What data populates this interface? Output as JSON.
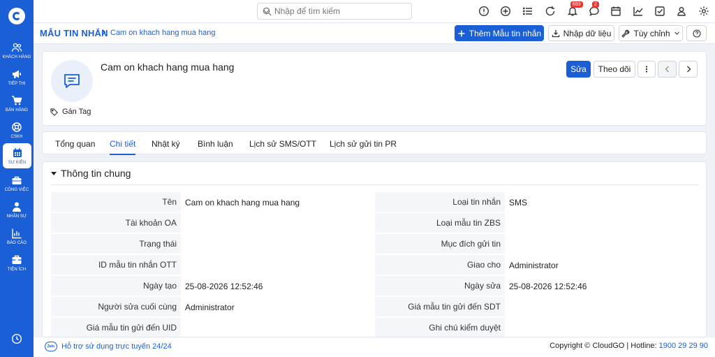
{
  "sidebar": {
    "items": [
      {
        "label": "KHÁCH HÀNG",
        "icon": "users-icon"
      },
      {
        "label": "TIẾP THỊ",
        "icon": "megaphone-icon"
      },
      {
        "label": "BÁN HÀNG",
        "icon": "cart-icon"
      },
      {
        "label": "CSKH",
        "icon": "lifebuoy-icon"
      },
      {
        "label": "SỰ KIỆN",
        "icon": "calendar-icon"
      },
      {
        "label": "CÔNG VIỆC",
        "icon": "briefcase-icon"
      },
      {
        "label": "NHÂN SỰ",
        "icon": "person-icon"
      },
      {
        "label": "BÁO CÁO",
        "icon": "report-icon"
      },
      {
        "label": "TIỆN ÍCH",
        "icon": "toolbox-icon"
      }
    ]
  },
  "topbar": {
    "search_placeholder": "Nhập để tìm kiếm",
    "notification_count": "693",
    "message_count": "2"
  },
  "breadcrumb": {
    "module": "MẪU TIN NHẮN",
    "record": "Cam on khach hang mua hang"
  },
  "actions": {
    "add": "Thêm Mẫu tin nhắn",
    "import": "Nhập dữ liệu",
    "customize": "Tùy chỉnh"
  },
  "record": {
    "title": "Cam on khach hang mua hang",
    "tag_label": "Gán Tag",
    "edit": "Sửa",
    "follow": "Theo dõi"
  },
  "tabs": [
    "Tổng quan",
    "Chi tiết",
    "Nhật ký",
    "Bình luận",
    "Lịch sử SMS/OTT",
    "Lịch sử gửi tin PR"
  ],
  "section": {
    "title": "Thông tin chung",
    "left": [
      {
        "label": "Tên",
        "value": "Cam on khach hang mua hang"
      },
      {
        "label": "Tài khoản OA",
        "value": ""
      },
      {
        "label": "Trạng thái",
        "value": ""
      },
      {
        "label": "ID mẫu tin nhắn OTT",
        "value": ""
      },
      {
        "label": "Ngày tạo",
        "value": "25-08-2026 12:52:46"
      },
      {
        "label": "Người sửa cuối cùng",
        "value": "Administrator"
      },
      {
        "label": "Giá mẫu tin gửi đến UID",
        "value": ""
      }
    ],
    "right": [
      {
        "label": "Loại tin nhắn",
        "value": "SMS"
      },
      {
        "label": "Loại mẫu tin ZBS",
        "value": ""
      },
      {
        "label": "Mục đích gửi tin",
        "value": ""
      },
      {
        "label": "Giao cho",
        "value": "Administrator"
      },
      {
        "label": "Ngày sửa",
        "value": "25-08-2026 12:52:46"
      },
      {
        "label": "Giá mẫu tin gửi đến SDT",
        "value": ""
      },
      {
        "label": "Ghi chú kiểm duyệt",
        "value": ""
      }
    ]
  },
  "footer": {
    "zalo": "Zalo",
    "support": "Hỗ trợ sử dụng trực tuyến 24/24",
    "copyright": "Copyright © CloudGO | Hotline: ",
    "hotline": "1900 29 29 90"
  },
  "colors": {
    "primary": "#1b5fd6",
    "badge": "#e53935"
  }
}
